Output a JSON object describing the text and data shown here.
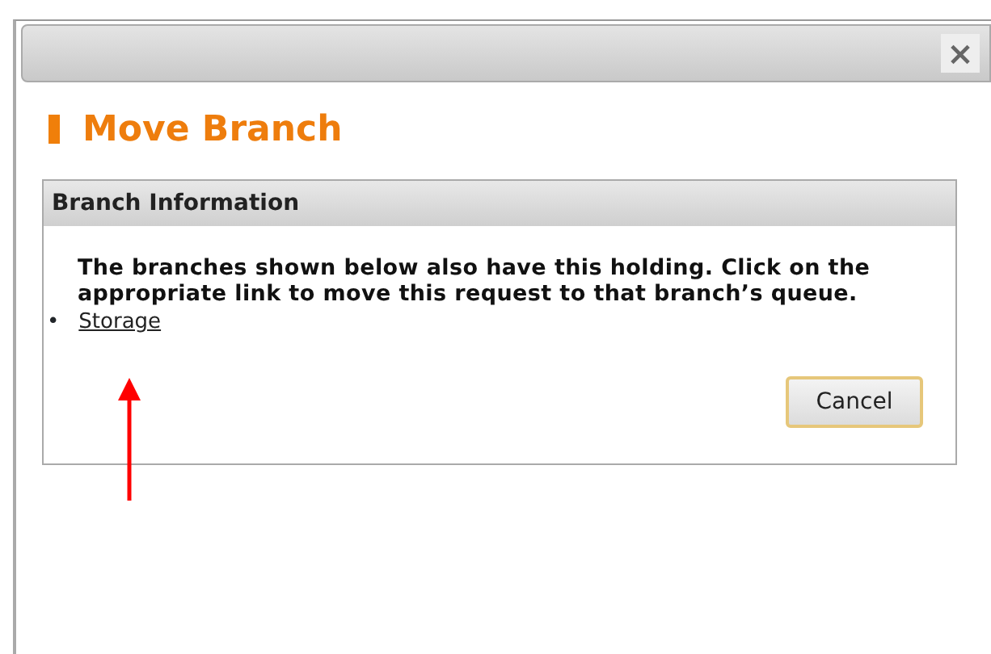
{
  "dialog": {
    "close_label": "×",
    "title": "Move Branch"
  },
  "panel": {
    "heading": "Branch Information",
    "message": "The branches shown below also have this holding. Click on the appropriate link to move this request to that branch’s queue.",
    "branches": [
      {
        "bullet": "•",
        "label": "Storage"
      }
    ]
  },
  "buttons": [
    {
      "label": "Cancel"
    }
  ]
}
